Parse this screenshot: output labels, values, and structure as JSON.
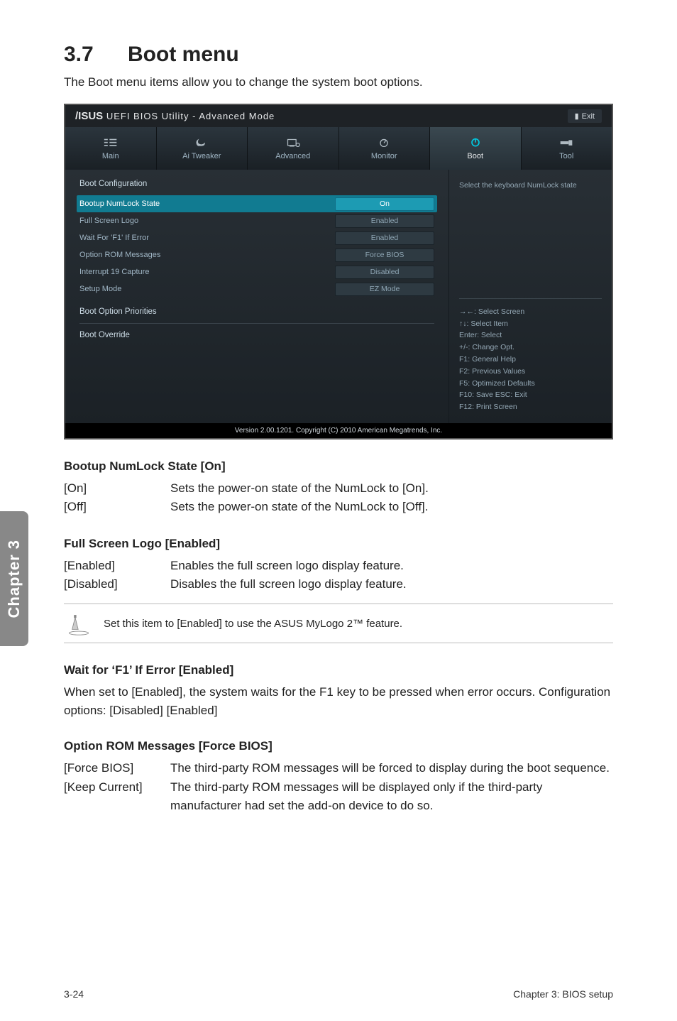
{
  "title_num": "3.7",
  "title_text": "Boot menu",
  "intro": "The Boot menu items allow you to change the system boot options.",
  "bios": {
    "logo_util": "UEFI BIOS Utility - Advanced Mode",
    "exit": "Exit",
    "tabs": {
      "main": "Main",
      "tweaker": "Ai Tweaker",
      "advanced": "Advanced",
      "monitor": "Monitor",
      "boot": "Boot",
      "tool": "Tool"
    },
    "section_bootcfg": "Boot Configuration",
    "rows": {
      "numlock": {
        "label": "Bootup NumLock State",
        "value": "On"
      },
      "logo": {
        "label": "Full Screen Logo",
        "value": "Enabled"
      },
      "f1": {
        "label": "Wait For 'F1' If Error",
        "value": "Enabled"
      },
      "oprom": {
        "label": "Option ROM Messages",
        "value": "Force BIOS"
      },
      "int19": {
        "label": "Interrupt 19 Capture",
        "value": "Disabled"
      },
      "setup": {
        "label": "Setup Mode",
        "value": "EZ Mode"
      }
    },
    "section_priorities": "Boot Option Priorities",
    "section_override": "Boot Override",
    "help_top": "Select the keyboard NumLock state",
    "help_keys": {
      "a": "→←:  Select Screen",
      "b": "↑↓:  Select Item",
      "c": "Enter:  Select",
      "d": "+/-:  Change Opt.",
      "e": "F1:  General Help",
      "f": "F2:  Previous Values",
      "g": "F5:  Optimized Defaults",
      "h": "F10:  Save   ESC:  Exit",
      "i": "F12: Print Screen"
    },
    "footer": "Version  2.00.1201.   Copyright  (C)  2010  American  Megatrends,  Inc."
  },
  "s1": {
    "head": "Bootup NumLock State [On]",
    "r1k": "[On]",
    "r1v": "Sets the power-on state of the NumLock to [On].",
    "r2k": "[Off]",
    "r2v": "Sets the power-on state of the NumLock to [Off]."
  },
  "s2": {
    "head": "Full Screen Logo [Enabled]",
    "r1k": "[Enabled]",
    "r1v": "Enables the full screen logo display feature.",
    "r2k": "[Disabled]",
    "r2v": "Disables the full screen logo display feature.",
    "note": "Set this item to [Enabled] to use the ASUS MyLogo 2™ feature."
  },
  "s3": {
    "head": "Wait for ‘F1’ If Error [Enabled]",
    "para": "When set to [Enabled], the system waits for the F1 key to be pressed when error occurs. Configuration options: [Disabled] [Enabled]"
  },
  "s4": {
    "head": "Option ROM Messages [Force BIOS]",
    "r1k": "[Force BIOS]",
    "r1v": "The third-party ROM messages will be forced to display during the boot sequence.",
    "r2k": "[Keep Current]",
    "r2v": "The third-party ROM messages will be displayed only if the third-party manufacturer had set the add-on device to do so."
  },
  "sidebar": "Chapter 3",
  "foot_l": "3-24",
  "foot_r": "Chapter 3: BIOS setup"
}
